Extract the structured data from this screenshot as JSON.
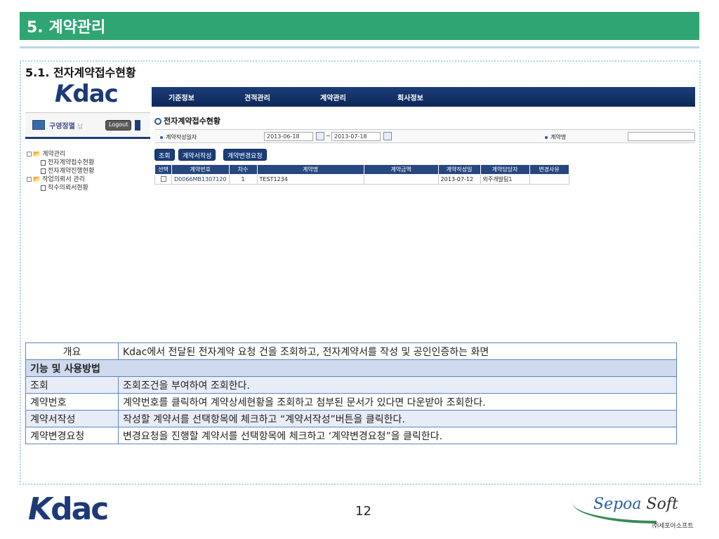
{
  "header": {
    "title": "5. 계약관리"
  },
  "section": {
    "title": "5.1. 전자계약접수현황"
  },
  "app": {
    "logo": {
      "k": "K",
      "rest": "dac"
    },
    "nav": [
      "기준정보",
      "견적관리",
      "계약관리",
      "회사정보"
    ],
    "user": {
      "name": "구영정멸",
      "suffix": "님",
      "logout": "Logout"
    },
    "tree": [
      {
        "type": "folder",
        "label": "계약관리"
      },
      {
        "type": "doc",
        "label": "전자계약접수현황"
      },
      {
        "type": "doc",
        "label": "전자계약진행현황"
      },
      {
        "type": "folder",
        "label": "작업의뢰서 관리"
      },
      {
        "type": "doc",
        "label": "작수의뢰서현황"
      }
    ],
    "page_title": "전자계약접수현황",
    "search": {
      "date_label": "계약작성일자",
      "date_from": "2013-06-18",
      "tilde": "~",
      "date_to": "2013-07-18",
      "name_label": "계약명"
    },
    "buttons": [
      "조회",
      "계약서작성",
      "계약변경요청"
    ],
    "grid": {
      "columns": [
        "선택",
        "계약번호",
        "차수",
        "계약명",
        "계약금액",
        "계약작성일",
        "계약담당자",
        "변경사유"
      ],
      "rows": [
        {
          "contract_no": "D0066MB1307120",
          "seq": "1",
          "name": "TEST1234",
          "amount": "",
          "date": "2013-07-12",
          "manager": "외주개발팀1",
          "reason": ""
        }
      ]
    }
  },
  "info": {
    "overview_key": "개요",
    "overview_val": "Kdac에서 전달된 전자계약 요청 건을 조회하고, 전자계약서를 작성 및 공인인증하는 화면",
    "features_head": "기능 및 사용방법",
    "rows": [
      {
        "k": "조회",
        "v": "조회조건을 부여하여 조회한다."
      },
      {
        "k": "계약번호",
        "v": "계약번호를 클릭하여 계약상세현황을 조회하고 첨부된 문서가 있다면 다운받아 조회한다."
      },
      {
        "k": "계약서작성",
        "v": "작성할 계약서를 선택항목에 체크하고 “계약서작성”버튼을 클릭한다."
      },
      {
        "k": "계약변경요청",
        "v": "변경요청을 진행할 계약서를 선택항목에 체크하고 ‘계약변경요청”을 클릭한다."
      }
    ]
  },
  "footer": {
    "logo": {
      "k": "K",
      "rest": "dac"
    },
    "page": "12",
    "brand_a": "Sepoa",
    "brand_b": "Soft",
    "brand_kr": "㈜세포아소프트"
  }
}
